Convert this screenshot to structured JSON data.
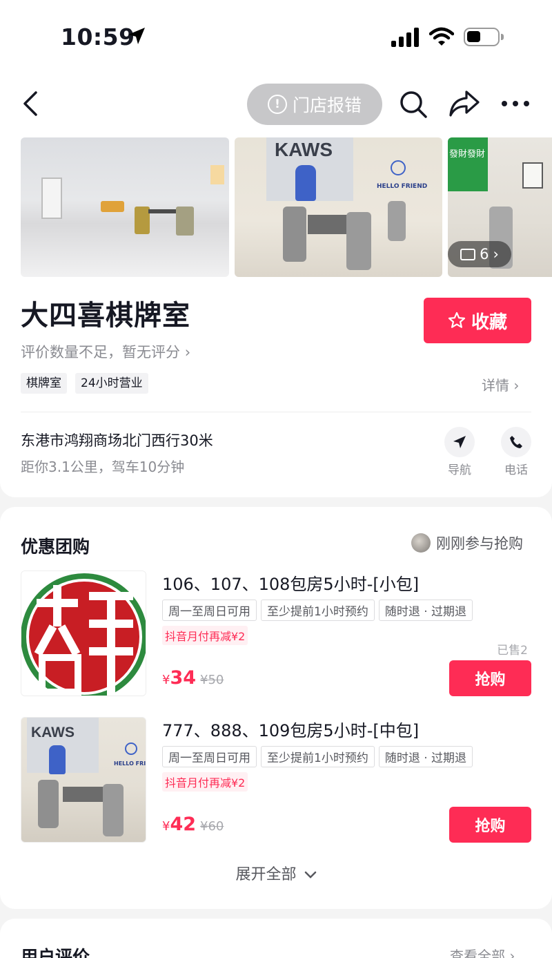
{
  "status_bar": {
    "time": "10:59"
  },
  "nav": {
    "report_label": "门店报错"
  },
  "gallery": {
    "photo_count": "6",
    "photo3_sign": "發財發財",
    "photo2_logo": "KAWS",
    "photo2_sign": "HELLO FRIEND"
  },
  "store": {
    "name": "大四喜棋牌室",
    "rating_text": "评价数量不足，暂无评分",
    "favorite_label": "收藏",
    "tags": [
      "棋牌室",
      "24小时营业"
    ],
    "details_label": "详情",
    "address": "东港市鸿翔商场北门西行30米",
    "distance": "距你3.1公里，驾车10分钟",
    "navigate_label": "导航",
    "call_label": "电话"
  },
  "deals": {
    "title": "优惠团购",
    "recent_text": "刚刚参与抢购",
    "items": [
      {
        "title": "106、107、108包房5小时-[小包]",
        "tags": [
          "周一至周日可用",
          "至少提前1小时预约",
          "随时退 · 过期退"
        ],
        "promo": "抖音月付再减¥2",
        "currency": "¥",
        "price": "34",
        "original_price": "¥50",
        "sold": "已售2",
        "buy_label": "抢购"
      },
      {
        "title": "777、888、109包房5小时-[中包]",
        "tags": [
          "周一至周日可用",
          "至少提前1小时预约",
          "随时退 · 过期退"
        ],
        "promo": "抖音月付再减¥2",
        "currency": "¥",
        "price": "42",
        "original_price": "¥60",
        "buy_label": "抢购"
      }
    ],
    "expand_label": "展开全部"
  },
  "reviews": {
    "title": "用户评价",
    "view_all": "查看全部"
  },
  "colors": {
    "accent": "#fe2c55",
    "text": "#161823",
    "secondary": "#8a8b91"
  }
}
